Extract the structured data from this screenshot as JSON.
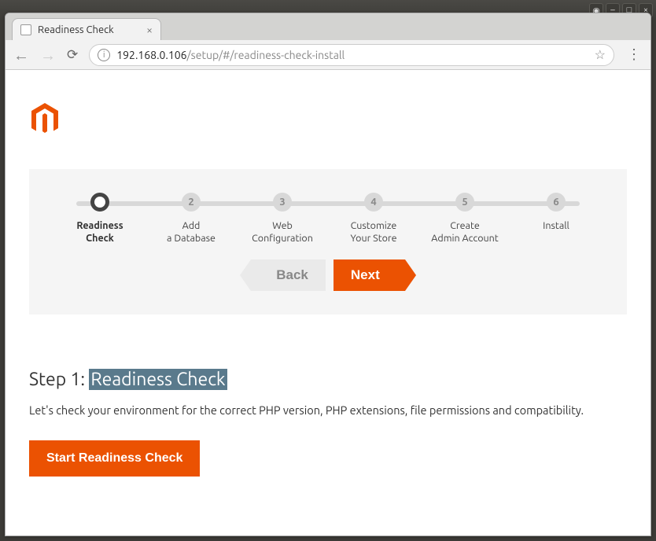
{
  "window": {
    "tab_title": "Readiness Check",
    "url_host": "192.168.0.106",
    "url_path": "/setup/#/readiness-check-install"
  },
  "progress": {
    "steps": [
      {
        "num": "",
        "label": "Readiness\nCheck",
        "active": true
      },
      {
        "num": "2",
        "label": "Add\na Database",
        "active": false
      },
      {
        "num": "3",
        "label": "Web\nConfiguration",
        "active": false
      },
      {
        "num": "4",
        "label": "Customize\nYour Store",
        "active": false
      },
      {
        "num": "5",
        "label": "Create\nAdmin Account",
        "active": false
      },
      {
        "num": "6",
        "label": "Install",
        "active": false
      }
    ],
    "back_label": "Back",
    "next_label": "Next"
  },
  "main": {
    "heading_prefix": "Step 1: ",
    "heading_highlight": "Readiness Check",
    "description": "Let's check your environment for the correct PHP version, PHP extensions, file permissions and compatibility.",
    "start_button": "Start Readiness Check"
  },
  "colors": {
    "accent": "#eb5202"
  }
}
